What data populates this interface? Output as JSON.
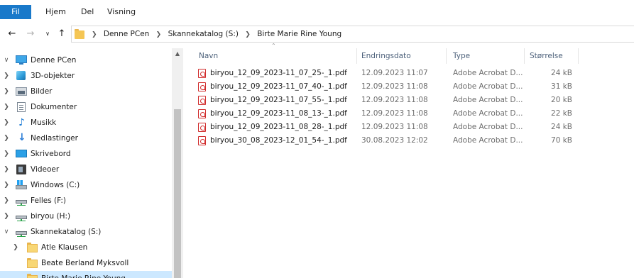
{
  "ribbon": {
    "tabs": [
      "Fil",
      "Hjem",
      "Del",
      "Visning"
    ],
    "accent": "#1979ca"
  },
  "nav": {
    "back_icon": "arrow-left",
    "forward_icon": "arrow-right",
    "recent_icon": "chevron-down",
    "up_icon": "arrow-up"
  },
  "address": {
    "crumbs": [
      "Denne PCen",
      "Skannekatalog (S:)",
      "Birte Marie Rine Young"
    ]
  },
  "navpane": {
    "items": [
      {
        "label": "Denne PCen",
        "icon": "computer-icon",
        "expanded": true
      },
      {
        "label": "3D-objekter",
        "icon": "cube-icon"
      },
      {
        "label": "Bilder",
        "icon": "pictures-icon"
      },
      {
        "label": "Dokumenter",
        "icon": "documents-icon"
      },
      {
        "label": "Musikk",
        "icon": "music-icon"
      },
      {
        "label": "Nedlastinger",
        "icon": "download-icon"
      },
      {
        "label": "Skrivebord",
        "icon": "desktop-icon"
      },
      {
        "label": "Videoer",
        "icon": "videos-icon"
      },
      {
        "label": "Windows (C:)",
        "icon": "windows-drive-icon"
      },
      {
        "label": "Felles (F:)",
        "icon": "network-drive-icon"
      },
      {
        "label": "biryou (H:)",
        "icon": "network-drive-icon"
      },
      {
        "label": "Skannekatalog (S:)",
        "icon": "network-drive-icon",
        "expanded": true
      },
      {
        "label": "Atle Klausen",
        "icon": "folder-icon"
      },
      {
        "label": "Beate Berland Myksvoll",
        "icon": "folder-icon"
      },
      {
        "label": "Birte Marie Rine Young",
        "icon": "folder-icon",
        "selected": true
      }
    ]
  },
  "columns": {
    "name": "Navn",
    "date": "Endringsdato",
    "type": "Type",
    "size": "Størrelse"
  },
  "files": [
    {
      "name": "biryou_12_09_2023-11_07_25-_1.pdf",
      "date": "12.09.2023 11:07",
      "type": "Adobe Acrobat D...",
      "size": "24 kB"
    },
    {
      "name": "biryou_12_09_2023-11_07_40-_1.pdf",
      "date": "12.09.2023 11:08",
      "type": "Adobe Acrobat D...",
      "size": "31 kB"
    },
    {
      "name": "biryou_12_09_2023-11_07_55-_1.pdf",
      "date": "12.09.2023 11:08",
      "type": "Adobe Acrobat D...",
      "size": "20 kB"
    },
    {
      "name": "biryou_12_09_2023-11_08_13-_1.pdf",
      "date": "12.09.2023 11:08",
      "type": "Adobe Acrobat D...",
      "size": "22 kB"
    },
    {
      "name": "biryou_12_09_2023-11_08_28-_1.pdf",
      "date": "12.09.2023 11:08",
      "type": "Adobe Acrobat D...",
      "size": "24 kB"
    },
    {
      "name": "biryou_30_08_2023-12_01_54-_1.pdf",
      "date": "30.08.2023 12:02",
      "type": "Adobe Acrobat D...",
      "size": "70 kB"
    }
  ]
}
